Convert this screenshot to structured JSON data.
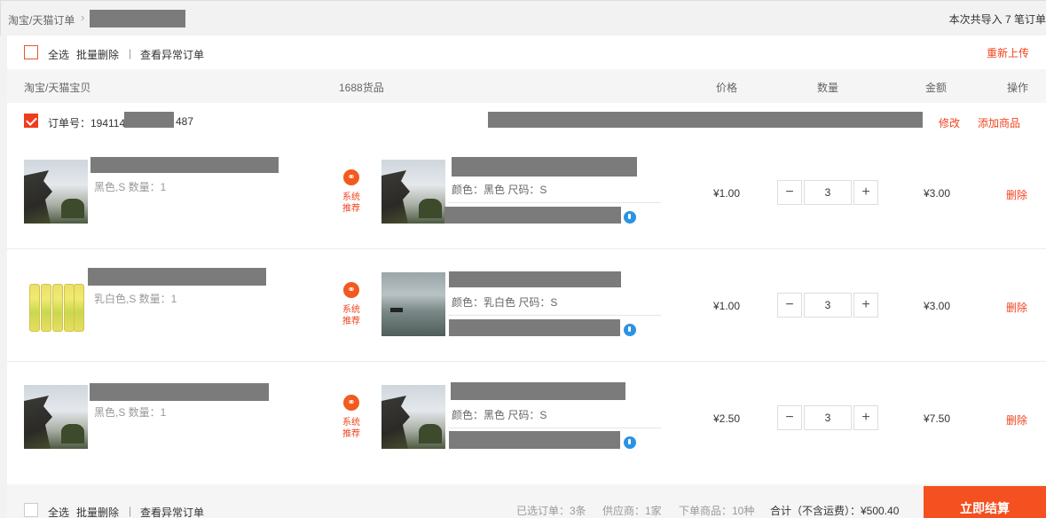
{
  "breadcrumb": {
    "root": "淘宝/天猫订单"
  },
  "import_info": "本次共导入 7 笔订单",
  "toolbar": {
    "select_all": "全选",
    "batch_delete": "批量删除",
    "divider": "|",
    "view_abnormal": "查看异常订单",
    "reupload": "重新上传"
  },
  "header": {
    "taobao_item": "淘宝/天猫宝贝",
    "goods_1688": "1688货品",
    "price": "价格",
    "quantity": "数量",
    "amount": "金额",
    "action": "操作"
  },
  "order": {
    "number_prefix": "订单号：194114",
    "number_suffix": "487",
    "edit": "修改",
    "add_product": "添加商品"
  },
  "rows": [
    {
      "taobao_spec": "黑色,S 数量：1",
      "rec_line1": "系统",
      "rec_line2": "推荐",
      "goods_spec": "颜色：黑色 尺码：S",
      "price": "¥1.00",
      "qty": "3",
      "amount": "¥3.00",
      "delete": "删除"
    },
    {
      "taobao_spec": "乳白色,S 数量：1",
      "rec_line1": "系统",
      "rec_line2": "推荐",
      "goods_spec": "颜色：乳白色 尺码：S",
      "price": "¥1.00",
      "qty": "3",
      "amount": "¥3.00",
      "delete": "删除"
    },
    {
      "taobao_spec": "黑色,S 数量：1",
      "rec_line1": "系统",
      "rec_line2": "推荐",
      "goods_spec": "颜色：黑色 尺码：S",
      "price": "¥2.50",
      "qty": "3",
      "amount": "¥7.50",
      "delete": "删除"
    }
  ],
  "stepper": {
    "minus": "−",
    "plus": "+"
  },
  "footer": {
    "select_all": "全选",
    "batch_delete": "批量删除",
    "divider": "|",
    "view_abnormal": "查看异常订单",
    "selected_orders": "已选订单：3条",
    "suppliers": "供应商：1家",
    "ordered_goods": "下单商品：10种",
    "total": "合计（不含运费）：¥500.40",
    "checkout": "立即结算"
  },
  "colors": {
    "accent": "#f0441f",
    "checkout_bg": "#f5501f",
    "link_blue": "#2b93e4"
  }
}
